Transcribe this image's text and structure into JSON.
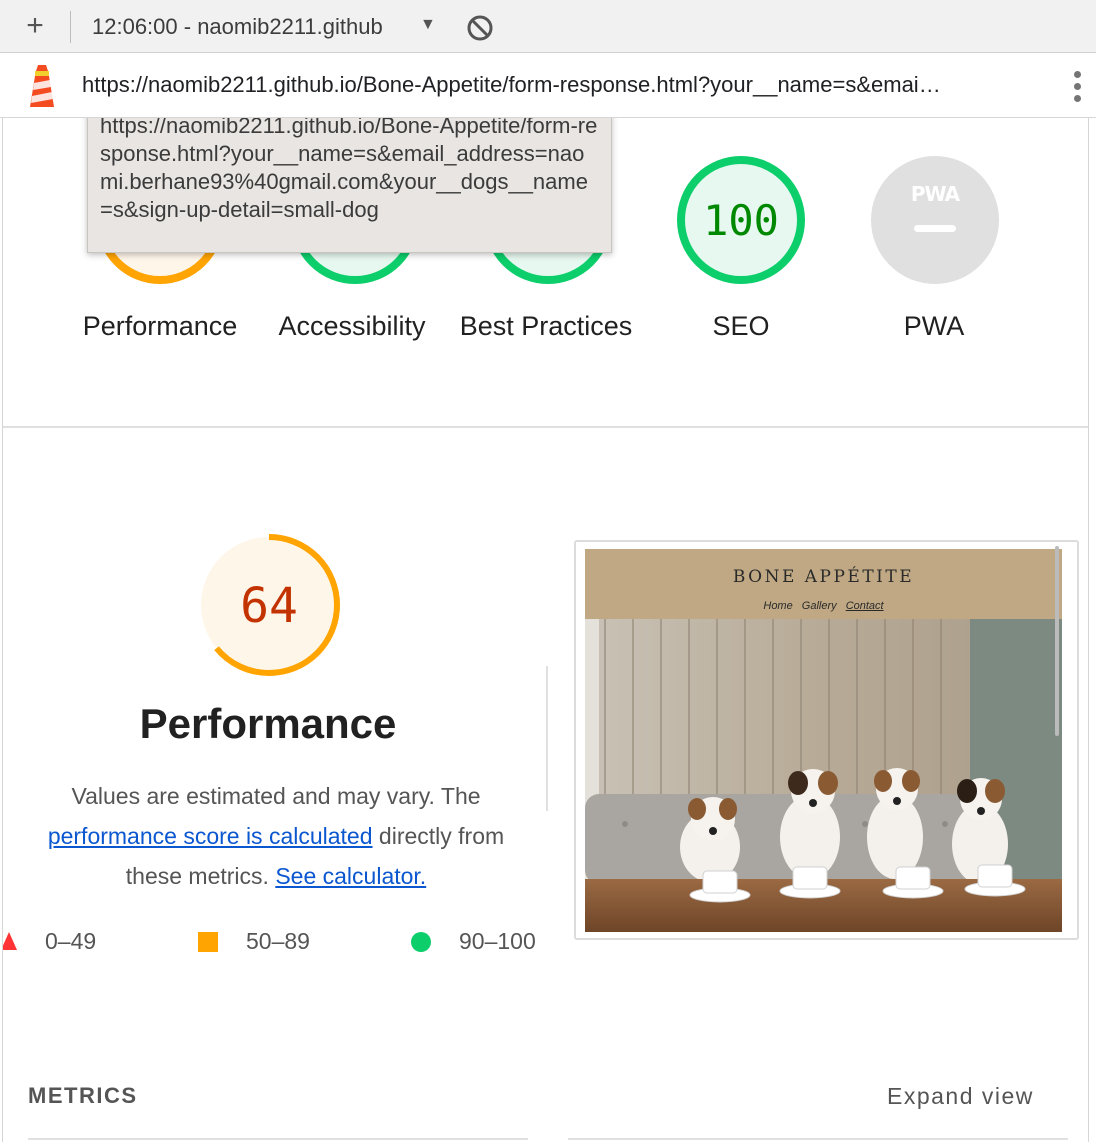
{
  "toolbar": {
    "plus_label": "+",
    "title": "12:06:00 - naomib2211.github",
    "caret": "▼"
  },
  "urlbar": {
    "url": "https://naomib2211.github.io/Bone-Appetite/form-response.html?your__name=s&emai…"
  },
  "tooltip": {
    "text": "https://naomib2211.github.io/Bone-Appetite/form-response.html?your__name=s&email_address=naomi.berhane93%40gmail.com&your__dogs__name=s&sign-up-detail=small-dog"
  },
  "categories": [
    {
      "label": "Performance",
      "score": 64,
      "status": "average"
    },
    {
      "label": "Accessibility",
      "score": null,
      "status": "pass"
    },
    {
      "label": "Best Practices",
      "score": null,
      "status": "pass"
    },
    {
      "label": "SEO",
      "score": 100,
      "status": "pass"
    },
    {
      "label": "PWA",
      "score": null,
      "status": "na",
      "badge": "PWA"
    }
  ],
  "seo_score": "100",
  "pwa_badge": "PWA",
  "performance": {
    "score": "64",
    "score_value": 64,
    "title": "Performance",
    "desc_prefix": "Values are estimated and may vary. The ",
    "desc_link": "performance score is calculated",
    "desc_middle": " directly from these metrics. ",
    "desc_link2": "See calculator."
  },
  "legend": [
    {
      "range": "0–49",
      "shape": "triangle",
      "color": "#ff3333"
    },
    {
      "range": "50–89",
      "shape": "square",
      "color": "#ffa400"
    },
    {
      "range": "90–100",
      "shape": "circle",
      "color": "#0cce6b"
    }
  ],
  "screenshot": {
    "brand": "BONE APPÉTITE",
    "nav": [
      "Home",
      "Gallery",
      "Contact"
    ]
  },
  "metrics": {
    "heading": "METRICS",
    "expand": "Expand view"
  },
  "colors": {
    "pass": "#0cce6b",
    "pass_bg": "#e6f8ef",
    "pass_text": "#008800",
    "average": "#ffa400",
    "average_bg": "#fff6ea",
    "average_text": "#c33300",
    "na": "#e0e0e0"
  },
  "icons": [
    "plus-icon",
    "block-icon",
    "lighthouse-icon",
    "kebab-menu-icon"
  ]
}
